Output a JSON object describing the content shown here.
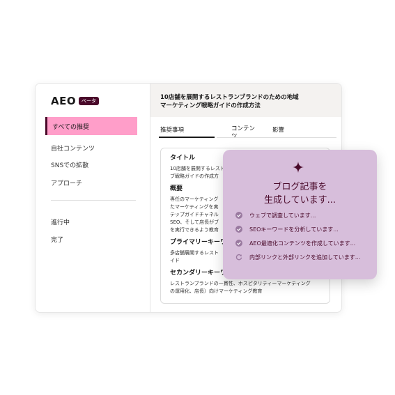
{
  "sidebar": {
    "logo": "AEO",
    "beta": "ベータ",
    "active_item": "すべての推奨",
    "items": [
      "自社コンテンツ",
      "SNSでの拡散",
      "アプローチ"
    ],
    "status_items": [
      "進行中",
      "完了"
    ]
  },
  "header": {
    "title_line1": "10店舗を展開するレストランブランドのための地域",
    "title_line2": "マーケティング戦略ガイドの作成方法"
  },
  "tabs": [
    "推奨事項",
    "コンテン\nツ",
    "影響"
  ],
  "card": {
    "title_label": "タイトル",
    "title_text": [
      "10店舗を展開するレスト",
      "ブ戦略ガイドの作成方"
    ],
    "summary_label": "概要",
    "summary_text": [
      "専任のマーケティング",
      "たマーケティングを実",
      "テップガイドチャネル",
      "SEO、そして店長がブ",
      "を実行できるよう教育"
    ],
    "primary_label": "プライマリーキーワ",
    "primary_text": [
      "多店舗展開するレスト",
      "イド"
    ],
    "secondary_label": "セカンダリーキーワ",
    "secondary_text": [
      "レストランブランドの一貫性、ホスピタリティーマーケティング",
      "の運用化、店長）向けマーケティング教育"
    ]
  },
  "overlay": {
    "title_line1": "ブログ記事を",
    "title_line2": "生成しています...",
    "steps": [
      {
        "icon": "check-circle-icon",
        "text": "ウェブで調査しています..."
      },
      {
        "icon": "check-circle-icon",
        "text": "SEOキーワードを分析しています..."
      },
      {
        "icon": "check-circle-icon",
        "text": "AEO最適化コンテンツを作成しています..."
      },
      {
        "icon": "refresh-icon",
        "text": "内部リンクと外部リンクを追加しています..."
      }
    ]
  },
  "colors": {
    "accent_dark": "#4a0a2a",
    "nav_active": "#ff9ec9",
    "overlay_bg": "#d7bedb"
  }
}
